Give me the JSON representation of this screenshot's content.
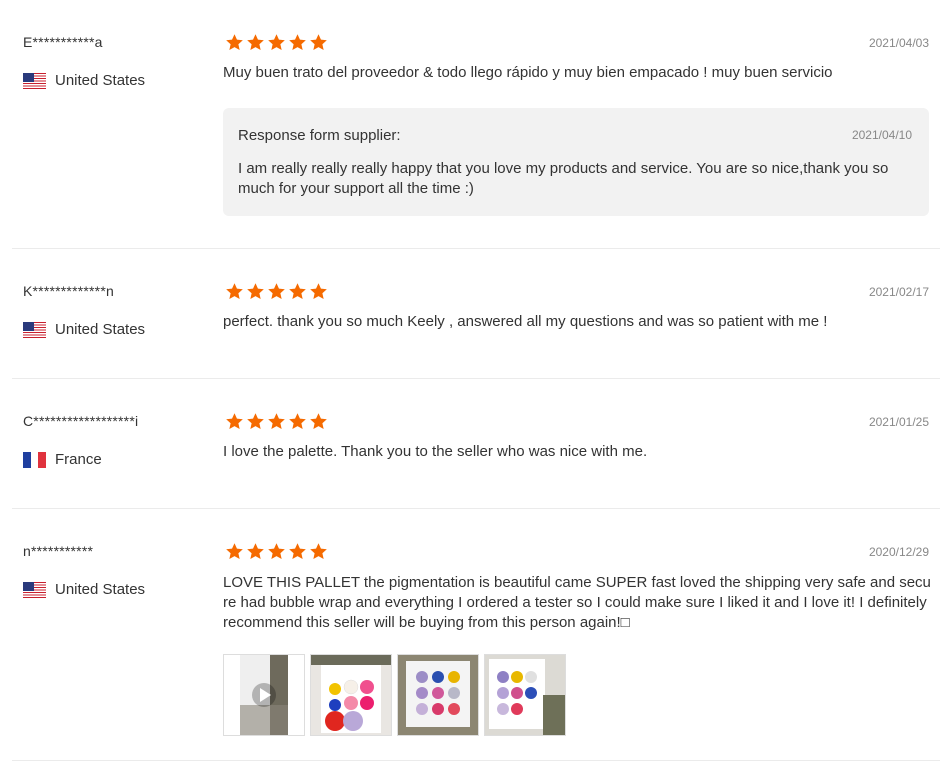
{
  "reviews": [
    {
      "user": "E***********a",
      "country": "United States",
      "flag": "us-flag",
      "stars": 5,
      "date": "2021/04/03",
      "text": "Muy buen trato del proveedor & todo llego rápido y muy bien empacado ! muy buen servicio",
      "response": {
        "title": "Response form supplier:",
        "date": "2021/04/10",
        "text": "I am really really really happy that you love my products and service. You are so nice,thank you so much for your support all the time :)"
      }
    },
    {
      "user": "K*************n",
      "country": "United States",
      "flag": "us-flag",
      "stars": 5,
      "date": "2021/02/17",
      "text": "perfect. thank you so much Keely , answered all my questions and was so patient with me !"
    },
    {
      "user": "C******************i",
      "country": "France",
      "flag": "france-flag",
      "stars": 5,
      "date": "2021/01/25",
      "text": "I love the palette. Thank you to the seller who was nice with me."
    },
    {
      "user": "n***********",
      "country": "United States",
      "flag": "us-flag",
      "stars": 5,
      "date": "2020/12/29",
      "text": "LOVE THIS PALLET the pigmentation is beautiful came SUPER fast loved the shipping very safe and secure had bubble wrap and everything I ordered a tester so I could make sure I liked it and I love it! I definitely recommend this seller will be buying from this person again!□",
      "thumbnails": [
        "video-thumbnail",
        "palette-photo",
        "palette-photo",
        "palette-photo"
      ]
    }
  ],
  "colors": {
    "star": "#f56a00",
    "response_bg": "#f2f2f2",
    "divider": "#ebebeb",
    "date": "#888888"
  }
}
